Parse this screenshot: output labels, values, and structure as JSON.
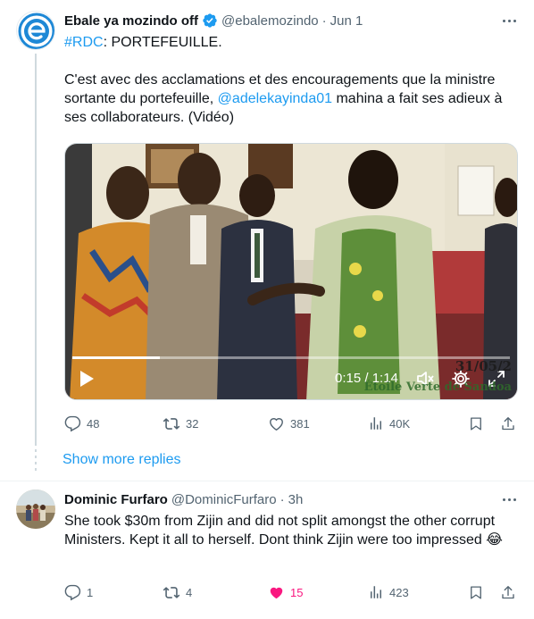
{
  "tweet1": {
    "name": "Ebale ya mozindo off",
    "handle": "@ebalemozindo",
    "dot": "·",
    "time": "Jun 1",
    "hashtag": "#RDC",
    "title_rest": ": PORTEFEUILLE.",
    "body_before": "C'est avec des acclamations et des encouragements que la ministre sortante du portefeuille, ",
    "mention": "@adelekayinda01",
    "body_after": " mahina a fait ses adieux à ses collaborateurs. (Vidéo)",
    "video": {
      "time_display": "0:15 / 1:14",
      "progress": 0.2,
      "watermark_date": "31/05/2",
      "watermark_name": "Étoile Verte de Sandoa"
    },
    "stats": {
      "replies": "48",
      "retweets": "32",
      "likes": "381",
      "views": "40K"
    }
  },
  "show_more": "Show more replies",
  "tweet2": {
    "name": "Dominic Furfaro",
    "handle": "@DominicFurfaro",
    "dot": "·",
    "time": "3h",
    "body": "She took $30m from Zijin and did not split amongst the other corrupt Ministers. Kept it all to herself. Dont think Zijin were too impressed 😂",
    "stats": {
      "replies": "1",
      "retweets": "4",
      "likes": "15",
      "views": "423"
    }
  },
  "colors": {
    "accent": "#1d9bf0",
    "text_secondary": "#536471",
    "like": "#f91880"
  },
  "icons": {
    "reply": "reply-icon",
    "retweet": "retweet-icon",
    "like": "heart-icon",
    "views": "views-icon",
    "bookmark": "bookmark-icon",
    "share": "share-icon"
  }
}
